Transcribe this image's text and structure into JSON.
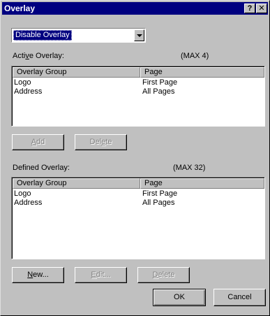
{
  "window": {
    "title": "Overlay",
    "help_label": "?",
    "close_label": "✕"
  },
  "overlay_mode": {
    "selected": "Disable Overlay"
  },
  "active": {
    "label_pre": "Acti",
    "label_key": "v",
    "label_post": "e Overlay:",
    "max": "(MAX 4)",
    "columns": [
      "Overlay Group",
      "Page"
    ],
    "rows": [
      {
        "group": "Logo",
        "page": "First Page"
      },
      {
        "group": "Address",
        "page": "All Pages"
      }
    ]
  },
  "active_buttons": {
    "add_key": "A",
    "add_rest": "dd",
    "delete_pre": "Del",
    "delete_key": "e",
    "delete_post": "te"
  },
  "defined": {
    "label": "Defined Overlay:",
    "max": "(MAX 32)",
    "columns": [
      "Overlay Group",
      "Page"
    ],
    "rows": [
      {
        "group": "Logo",
        "page": "First Page"
      },
      {
        "group": "Address",
        "page": "All Pages"
      }
    ]
  },
  "defined_buttons": {
    "new_key": "N",
    "new_rest": "ew...",
    "edit_key": "E",
    "edit_rest": "dit...",
    "delete_key": "D",
    "delete_rest": "elete"
  },
  "footer": {
    "ok": "OK",
    "cancel": "Cancel"
  }
}
